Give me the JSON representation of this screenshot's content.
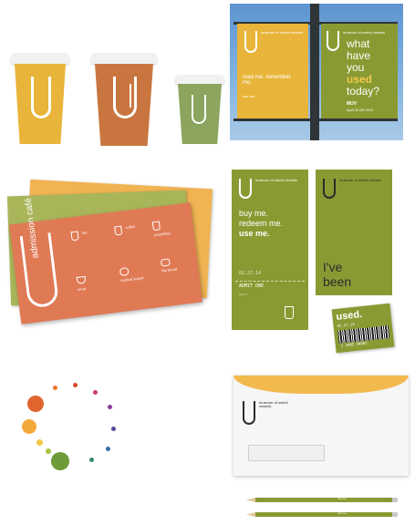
{
  "colors": {
    "yellow": "#e8b53a",
    "orange": "#d9845a",
    "olive": "#8a9a33",
    "sage": "#8ca55e",
    "coral": "#e07a55",
    "sky": "#6fa6d8",
    "envelope_flap": "#f2b94e"
  },
  "banner": {
    "left_title": "museum of useful vessels",
    "left_tagline": "read me. remember me.",
    "left_small": "use me.",
    "right_title": "museum of useful vessels",
    "right_headline_1": "what",
    "right_headline_2": "have",
    "right_headline_3": "you",
    "right_headline_4": "used",
    "right_headline_5": "today?",
    "right_small_1": "MUV",
    "right_small_2": "April 30-28 2014"
  },
  "menu": {
    "title_1": "admission",
    "title_2": "café",
    "items": [
      "tea",
      "coffee",
      "smoothies",
      "soup",
      "tropical yogurt",
      "flat bread"
    ]
  },
  "ticket": {
    "org": "museum of useful vessels",
    "headline_1": "buy me.",
    "headline_2": "redeem me.",
    "headline_3": "use me.",
    "date": "02.27.14",
    "admit": "ADMIT ONE",
    "detail": "Adult",
    "right_org": "museum of useful vessels",
    "right_text_1": "I've",
    "right_text_2": "been"
  },
  "tag": {
    "word": "used.",
    "date": "02.27.14",
    "barcode_number": "2 3485 40802"
  },
  "envelope": {
    "org": "museum of useful vessels"
  },
  "pencil": {
    "label": "use me"
  },
  "dots": [
    {
      "color": "#e0642d",
      "size": 18
    },
    {
      "color": "#f2a93b",
      "size": 16
    },
    {
      "color": "#f2c94c",
      "size": 7
    },
    {
      "color": "#a8c43f",
      "size": 6
    },
    {
      "color": "#6f9a3a",
      "size": 20
    },
    {
      "color": "#3a8a6a",
      "size": 5
    },
    {
      "color": "#3a6aa8",
      "size": 5
    },
    {
      "color": "#5a4aa0",
      "size": 5
    },
    {
      "color": "#8a3a9a",
      "size": 5
    },
    {
      "color": "#c93a6a",
      "size": 5
    },
    {
      "color": "#d9462d",
      "size": 5
    },
    {
      "color": "#e9762d",
      "size": 5
    }
  ]
}
